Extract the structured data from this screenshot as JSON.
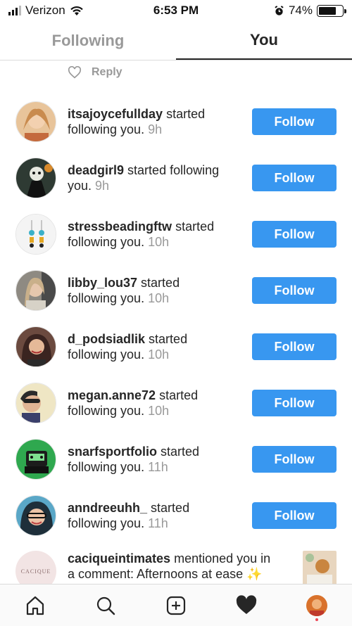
{
  "status_bar": {
    "carrier": "Verizon",
    "time": "6:53 PM",
    "battery": "74%",
    "battery_level": 0.74
  },
  "tabs": [
    {
      "label": "Following",
      "active": false
    },
    {
      "label": "You",
      "active": true
    }
  ],
  "reply": {
    "label": "Reply"
  },
  "follow_label": "Follow",
  "notifications": [
    {
      "user": "itsajoycefullday",
      "prefix": "started",
      "line2": "following you.",
      "time": "9h",
      "avatar_color": "#c9925f"
    },
    {
      "user": "deadgirl9",
      "prefix": "started following",
      "line2": "you.",
      "time": "9h",
      "avatar_color": "#3a4a3e"
    },
    {
      "user": "stressbeadingftw",
      "prefix": "started",
      "line2": "following you.",
      "time": "10h",
      "avatar_color": "#f1f1f1"
    },
    {
      "user": "libby_lou37",
      "prefix": "started",
      "line2": "following you.",
      "time": "10h",
      "avatar_color": "#a8a39a"
    },
    {
      "user": "d_podsiadlik",
      "prefix": "started",
      "line2": "following you.",
      "time": "10h",
      "avatar_color": "#5a3a33"
    },
    {
      "user": "megan.anne72",
      "prefix": "started",
      "line2": "following you.",
      "time": "10h",
      "avatar_color": "#e9d7a8"
    },
    {
      "user": "snarfsportfolio",
      "prefix": "started",
      "line2": "following you.",
      "time": "11h",
      "avatar_color": "#2fa84f"
    },
    {
      "user": "anndreeuhh_",
      "prefix": "started",
      "line2": "following you.",
      "time": "11h",
      "avatar_color": "#3b6f8a"
    }
  ],
  "mention": {
    "user": "caciqueintimates",
    "text1": "mentioned you in",
    "text2": "a comment: Afternoons at ease ✨",
    "logo_text": "CACIQUE"
  },
  "nav_icons": [
    "home-icon",
    "search-icon",
    "add-post-icon",
    "activity-heart-icon",
    "profile-avatar"
  ]
}
